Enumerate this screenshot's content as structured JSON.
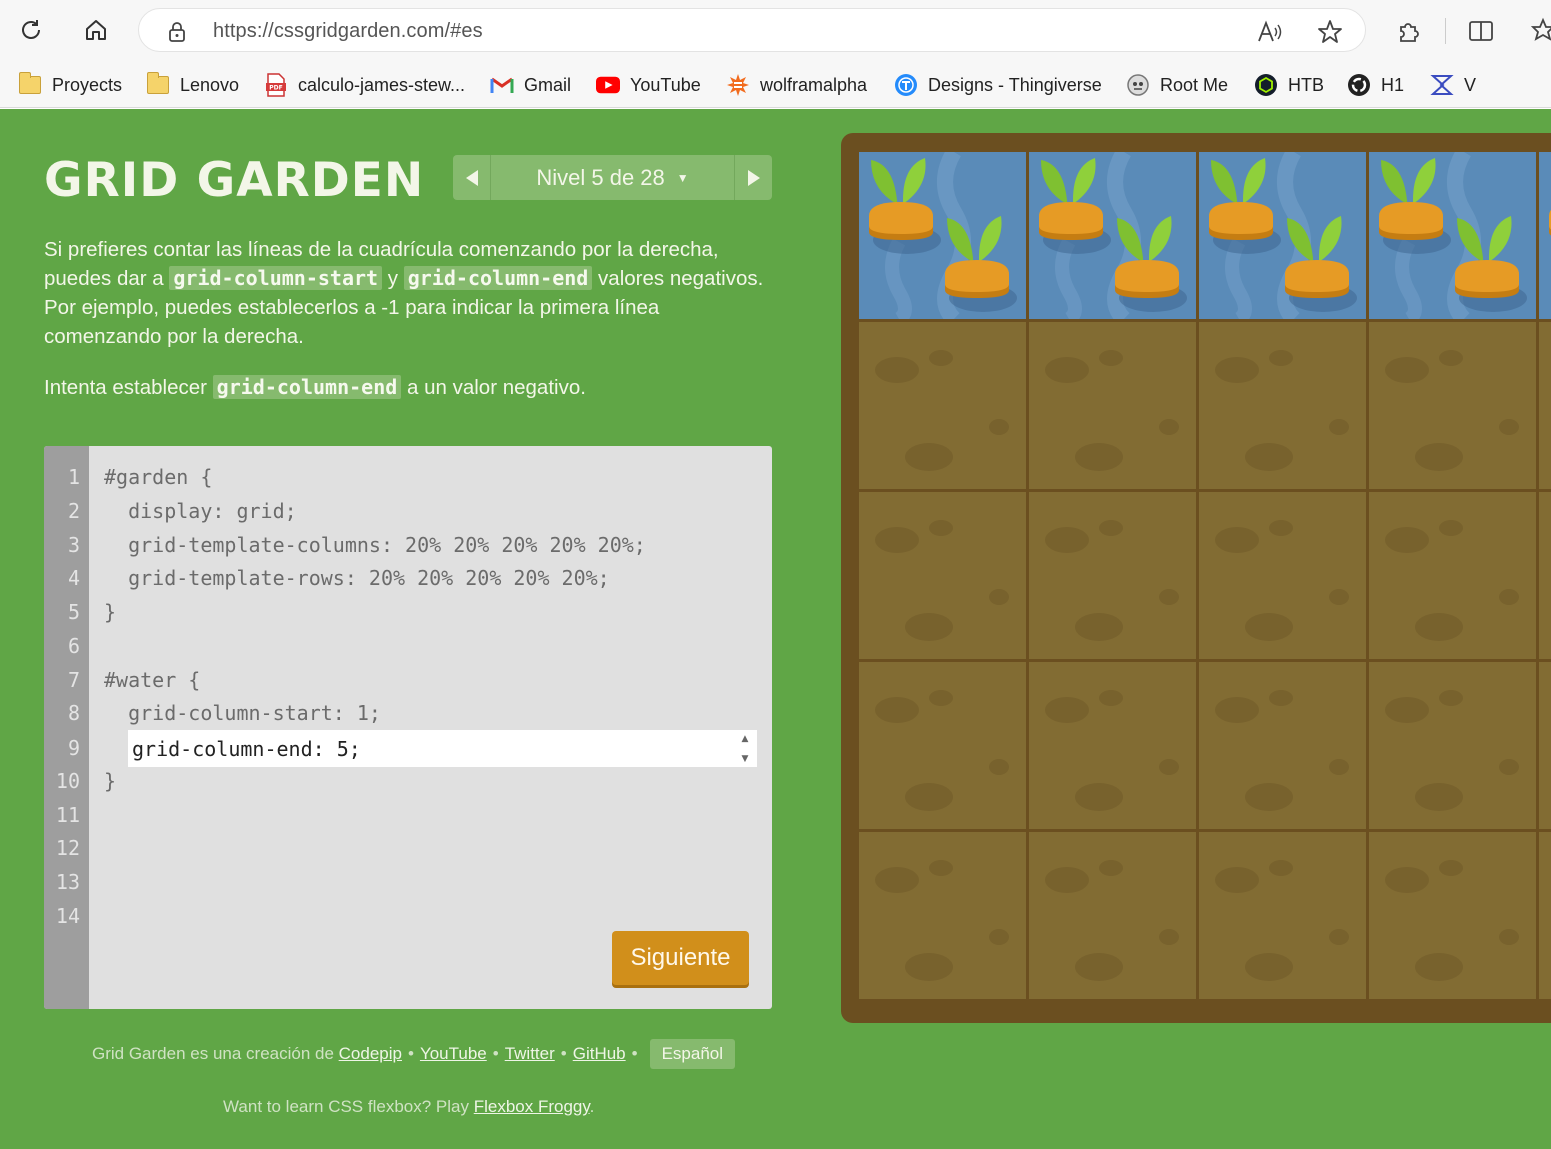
{
  "browser": {
    "url": "https://cssgridgarden.com/#es",
    "bookmarks": [
      {
        "label": "Proyects",
        "icon": "folder-icon"
      },
      {
        "label": "Lenovo",
        "icon": "folder-icon"
      },
      {
        "label": "calculo-james-stew...",
        "icon": "pdf-icon"
      },
      {
        "label": "Gmail",
        "icon": "gmail-icon"
      },
      {
        "label": "YouTube",
        "icon": "youtube-icon"
      },
      {
        "label": "wolframalpha",
        "icon": "wolfram-icon"
      },
      {
        "label": "Designs - Thingiverse",
        "icon": "thingiverse-icon"
      },
      {
        "label": "Root Me",
        "icon": "rootme-icon"
      },
      {
        "label": "HTB",
        "icon": "htb-icon"
      },
      {
        "label": "H1",
        "icon": "h1-icon"
      },
      {
        "label": "V",
        "icon": "v-icon"
      }
    ]
  },
  "game": {
    "title": "GRID GARDEN",
    "level_label": "Nivel 5 de 28",
    "instructions": {
      "p1_a": "Si prefieres contar las líneas de la cuadrícula comenzando por la derecha, puedes dar a ",
      "code1": "grid-column-start",
      "p1_b": " y ",
      "code2": "grid-column-end",
      "p1_c": " valores negativos. Por ejemplo, puedes establecerlos a -1 para indicar la primera línea comenzando por la derecha.",
      "p2_a": "Intenta establecer ",
      "code3": "grid-column-end",
      "p2_b": " a un valor negativo."
    },
    "editor": {
      "line_numbers": [
        "1",
        "2",
        "3",
        "4",
        "5",
        "6",
        "7",
        "8",
        "9",
        "10",
        "11",
        "12",
        "13",
        "14"
      ],
      "lines": [
        "#garden {",
        "  display: grid;",
        "  grid-template-columns: 20% 20% 20% 20% 20%;",
        "  grid-template-rows: 20% 20% 20% 20% 20%;",
        "}",
        "",
        "#water {",
        "  grid-column-start: 1;",
        "",
        "}"
      ],
      "input_value": "grid-column-end: 5;",
      "next_button": "Siguiente"
    },
    "footer": {
      "credit_text": "Grid Garden es una creación de",
      "codepip": "Codepip",
      "youtube": "YouTube",
      "twitter": "Twitter",
      "github": "GitHub",
      "language": "Español",
      "flexbox_prefix": "Want to learn CSS flexbox? Play",
      "flexbox_link": "Flexbox Froggy",
      "flexbox_suffix": "."
    },
    "garden": {
      "rows": 5,
      "columns_visible": 4,
      "water_row": 1,
      "colors": {
        "water": "#5a8bb8",
        "soil": "#826c33",
        "frame": "#6b4f20",
        "carrot": "#e69b25",
        "leaf": "#7fc031"
      }
    }
  }
}
